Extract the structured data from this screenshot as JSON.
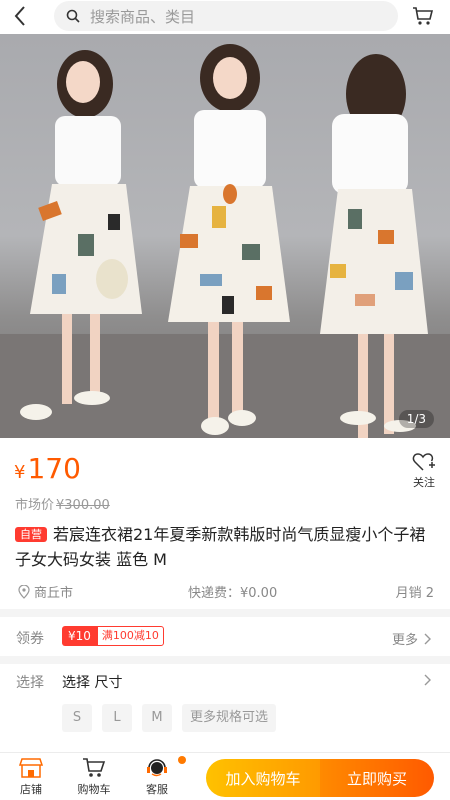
{
  "header": {
    "back_icon": "chevron-left-icon",
    "search_placeholder": "搜索商品、类目",
    "cart_icon": "cart-icon"
  },
  "gallery": {
    "counter": "1/3"
  },
  "price": {
    "currency": "¥",
    "amount": "170",
    "market_label": "市场价",
    "market_value": "¥300.00"
  },
  "follow": {
    "label": "关注",
    "icon": "heart-plus-icon"
  },
  "product": {
    "badge": "自营",
    "title": "若宸连衣裙21年夏季新款韩版时尚气质显瘦小个子裙子女大码女装 蓝色 M"
  },
  "meta": {
    "location": "商丘市",
    "shipping": "快递费：¥0.00",
    "sales": "月销 2"
  },
  "coupon": {
    "label": "领券",
    "amount": "¥10",
    "rule": "满100减10",
    "more": "更多"
  },
  "select": {
    "label": "选择",
    "text": "选择 尺寸",
    "options": [
      "S",
      "L",
      "M",
      "更多规格可选"
    ]
  },
  "bottom_bar": {
    "store": "店铺",
    "cart": "购物车",
    "service": "客服",
    "add_to_cart": "加入购物车",
    "buy_now": "立即购买"
  },
  "colors": {
    "accent": "#ff5a00",
    "badge_red": "#ff3b30",
    "cart_yellow": "#ffb000"
  }
}
